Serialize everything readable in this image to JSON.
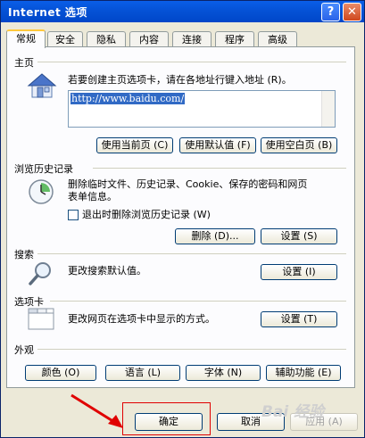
{
  "window": {
    "title": "Internet 选项",
    "help_glyph": "?",
    "close_glyph": "✕"
  },
  "tabs": [
    "常规",
    "安全",
    "隐私",
    "内容",
    "连接",
    "程序",
    "高级"
  ],
  "homepage": {
    "group_label": "主页",
    "description": "若要创建主页选项卡，请在各地址行键入地址 (R)。",
    "url": "http://www.baidu.com/",
    "buttons": {
      "current": "使用当前页 (C)",
      "default": "使用默认值 (F)",
      "blank": "使用空白页 (B)"
    }
  },
  "history": {
    "group_label": "浏览历史记录",
    "description_line1": "删除临时文件、历史记录、Cookie、保存的密码和网页",
    "description_line2": "表单信息。",
    "checkbox_label": "退出时删除浏览历史记录 (W)",
    "buttons": {
      "delete": "删除 (D)...",
      "settings": "设置 (S)"
    }
  },
  "search": {
    "group_label": "搜索",
    "description": "更改搜索默认值。",
    "settings_button": "设置 (I)"
  },
  "tabs_group": {
    "group_label": "选项卡",
    "description": "更改网页在选项卡中显示的方式。",
    "settings_button": "设置 (T)"
  },
  "appearance": {
    "group_label": "外观",
    "buttons": {
      "colors": "颜色 (O)",
      "languages": "语言 (L)",
      "fonts": "字体 (N)",
      "accessibility": "辅助功能 (E)"
    }
  },
  "footer": {
    "ok": "确定",
    "cancel": "取消",
    "apply": "应用 (A)"
  },
  "watermark": "Bai 经验",
  "accent_colors": {
    "title_bar": "#0552d6",
    "highlight_box": "#e00000",
    "arrow": "#e00000"
  },
  "icons": [
    "house-icon",
    "history-clock-icon",
    "magnifier-search-icon",
    "tabs-window-icon",
    "red-arrow-annotation"
  ]
}
